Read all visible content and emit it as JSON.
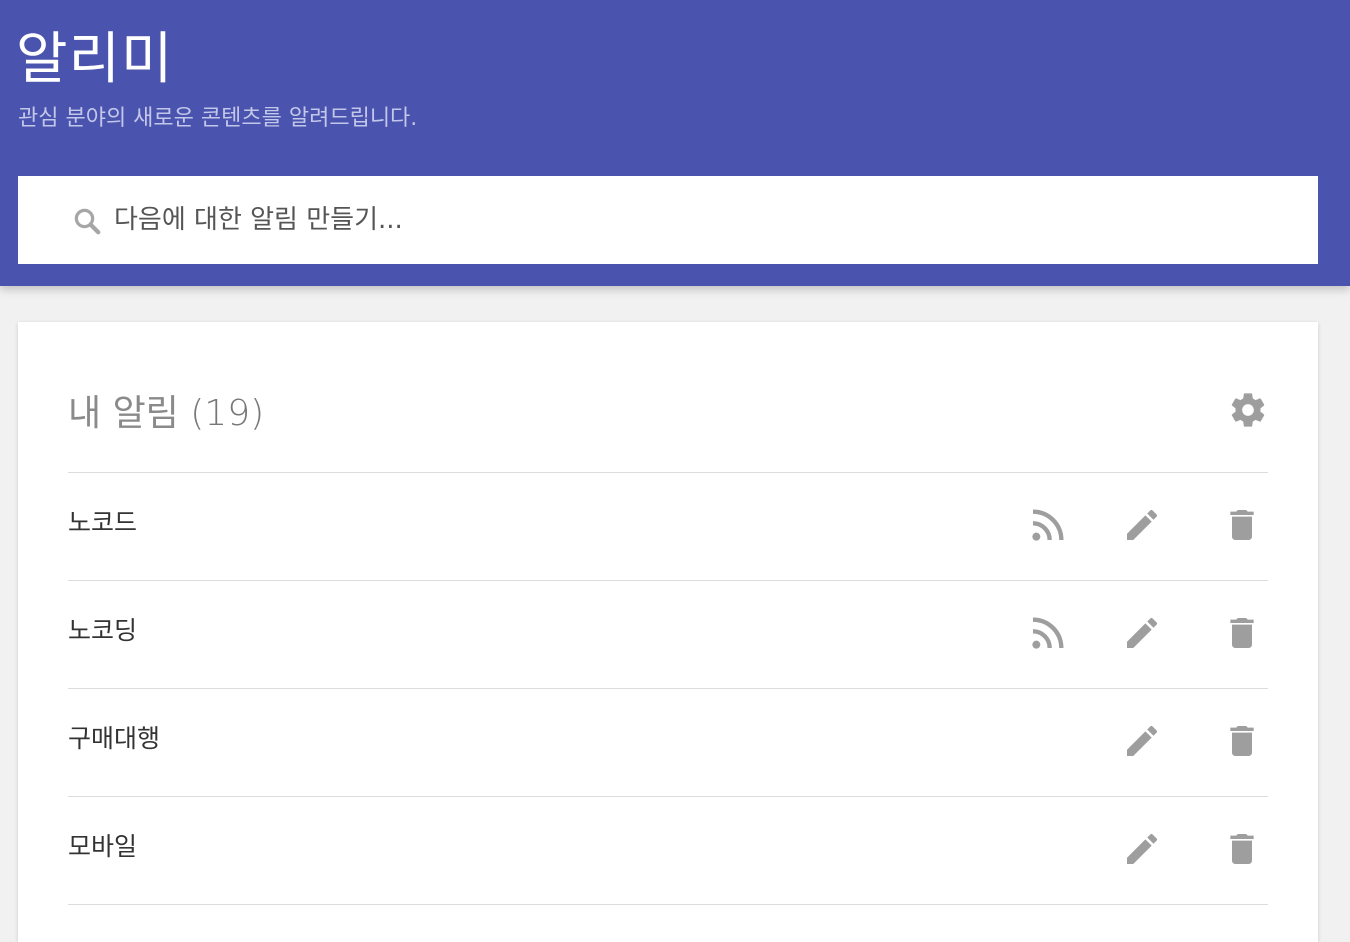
{
  "header": {
    "title": "알리미",
    "subtitle": "관심 분야의 새로운 콘텐츠를 알려드립니다."
  },
  "search": {
    "placeholder": "다음에 대한 알림 만들기..."
  },
  "alerts_card": {
    "title": "내 알림",
    "count": "(19)",
    "items": [
      {
        "label": "노코드",
        "has_rss": true
      },
      {
        "label": "노코딩",
        "has_rss": true
      },
      {
        "label": "구매대행",
        "has_rss": false
      },
      {
        "label": "모바일",
        "has_rss": false
      }
    ]
  },
  "colors": {
    "header_bg": "#4a53ae",
    "icon_gray": "#9e9e9e"
  }
}
